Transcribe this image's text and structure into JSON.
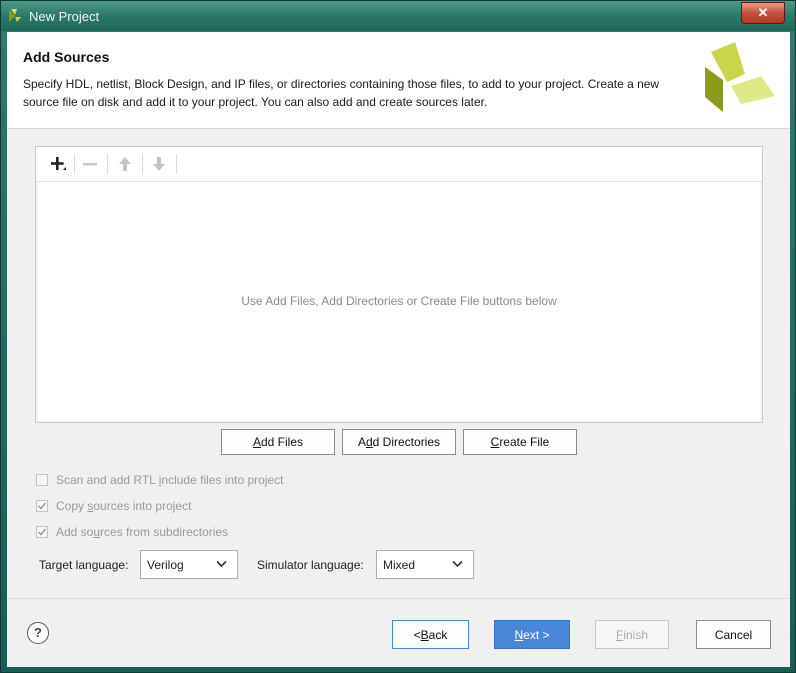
{
  "window": {
    "title": "New Project",
    "close_glyph": "✕"
  },
  "header": {
    "title": "Add Sources",
    "description": "Specify HDL, netlist, Block Design, and IP files, or directories containing those files, to add to your project. Create a new source file on disk and add it to your project. You can also add and create sources later."
  },
  "toolbar": {
    "icons": [
      "add-icon",
      "remove-icon",
      "move-up-icon",
      "move-down-icon"
    ]
  },
  "files_panel": {
    "empty_message": "Use Add Files, Add Directories or Create File buttons below"
  },
  "buttons": {
    "add_files": {
      "pre": "",
      "key": "A",
      "post": "dd Files"
    },
    "add_directories": {
      "pre": "A",
      "key": "d",
      "post": "d Directories"
    },
    "create_file": {
      "pre": "",
      "key": "C",
      "post": "reate File"
    }
  },
  "options": {
    "scan_rtl": {
      "pre": "Scan and add RTL ",
      "key": "i",
      "post": "nclude files into project",
      "checked": false
    },
    "copy_sources": {
      "pre": "Copy ",
      "key": "s",
      "post": "ources into project",
      "checked": true
    },
    "add_subdirs": {
      "pre": "Add so",
      "key": "u",
      "post": "rces from subdirectories",
      "checked": true
    }
  },
  "language": {
    "target_label": "Target language:",
    "target_value": "Verilog",
    "simulator_label": "Simulator language:",
    "simulator_value": "Mixed"
  },
  "footer": {
    "help_glyph": "?",
    "back": {
      "pre": "< ",
      "key": "B",
      "post": "ack"
    },
    "next": {
      "pre": "",
      "key": "N",
      "post": "ext >"
    },
    "finish": {
      "pre": "",
      "key": "F",
      "post": "inish"
    },
    "cancel": "Cancel"
  },
  "colors": {
    "accent": "#4a86d8",
    "title_bar": "#2e7b6a",
    "logo_light": "#d4e05c",
    "logo_dark": "#8c9a1d"
  }
}
